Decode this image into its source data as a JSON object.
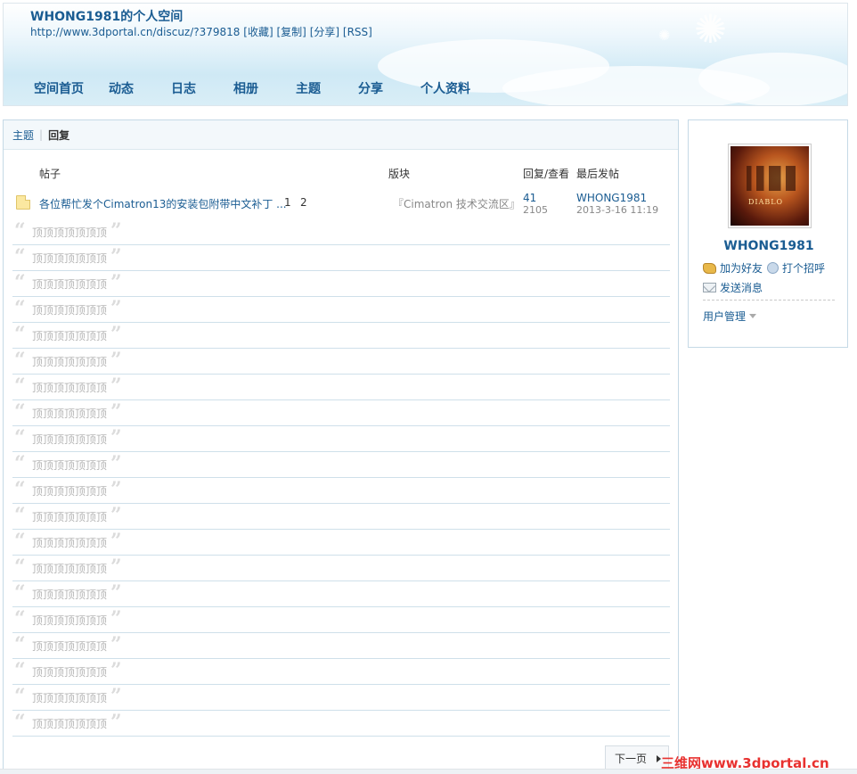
{
  "header": {
    "title": "WHONG1981的个人空间",
    "url": "http://www.3dportal.cn/discuz/?379818",
    "links": [
      "[收藏]",
      "[复制]",
      "[分享]",
      "[RSS]"
    ],
    "nav": [
      "空间首页",
      "动态",
      "日志",
      "相册",
      "主题",
      "分享",
      "个人资料"
    ]
  },
  "tabs": {
    "items": [
      "主题",
      "回复"
    ],
    "active": "回复"
  },
  "columns": {
    "post": "帖子",
    "forum": "版块",
    "reply_view": "回复/查看",
    "last_post": "最后发帖"
  },
  "thread": {
    "title": "各位帮忙发个Cimatron13的安装包附带中文补丁 ...",
    "pages": [
      "1",
      "2"
    ],
    "forum": "『Cimatron 技术交流区』",
    "replies": "41",
    "views": "2105",
    "last_user": "WHONG1981",
    "last_time": "2013-3-16 11:19"
  },
  "quotes": {
    "text": "顶顶顶顶顶顶顶",
    "count": 20
  },
  "pagination": {
    "next": "下一页"
  },
  "sidebar": {
    "username": "WHONG1981",
    "add_friend": "加为好友",
    "greet": "打个招呼",
    "send_message": "发送消息",
    "user_manage": "用户管理"
  },
  "watermark": "三维网www.3dportal.cn",
  "colors": {
    "link": "#1a5c92",
    "border": "#c5d9e6",
    "watermark": "#e8312f"
  }
}
